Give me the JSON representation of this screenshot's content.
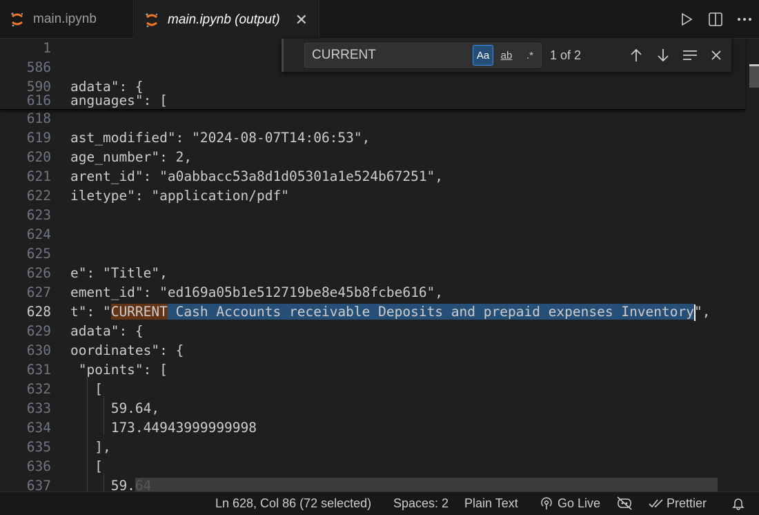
{
  "tabs": [
    {
      "label": "main.ipynb",
      "active": false
    },
    {
      "label": "main.ipynb (output)",
      "active": true
    }
  ],
  "icons": {
    "tab_icon": "jupyter-icon",
    "tab_close": "close-icon",
    "run": "play-icon",
    "split": "split-editor-icon",
    "more": "more-icon"
  },
  "colors": {
    "accent": "#3794ff",
    "selection": "#264f78",
    "current_match": "#623315",
    "jupyter_orange": "#f37726"
  },
  "find": {
    "query": "CURRENT",
    "match_case_label": "Aa",
    "whole_word_label": "ab",
    "regex_label": ".*",
    "count": "1 of 2",
    "match_case_enabled": true
  },
  "sticky_lines": [
    {
      "num": "1",
      "code": ""
    },
    {
      "num": "586",
      "code": ""
    },
    {
      "num": "590",
      "code": "adata\": {"
    },
    {
      "num": "616",
      "code": "anguages\": ["
    }
  ],
  "lines": [
    {
      "num": "618",
      "code": ""
    },
    {
      "num": "619",
      "code": "ast_modified\": \"2024-08-07T14:06:53\","
    },
    {
      "num": "620",
      "code": "age_number\": 2,"
    },
    {
      "num": "621",
      "code": "arent_id\": \"a0abbacc53a8d1d05301a1e524b67251\","
    },
    {
      "num": "622",
      "code": "iletype\": \"application/pdf\""
    },
    {
      "num": "623",
      "code": ""
    },
    {
      "num": "624",
      "code": ""
    },
    {
      "num": "625",
      "code": ""
    },
    {
      "num": "626",
      "code": "e\": \"Title\","
    },
    {
      "num": "627",
      "code": "ement_id\": \"ed169a05b1e512719be8e45b8fcbe616\","
    },
    {
      "num": "628",
      "code_pre": "t\": \"",
      "match": "CURRENT",
      "selected": " Cash Accounts receivable Deposits and prepaid expenses Inventory",
      "code_post": "\","
    },
    {
      "num": "629",
      "code": "adata\": {"
    },
    {
      "num": "630",
      "code": "oordinates\": {"
    },
    {
      "num": "631",
      "code": " \"points\": ["
    },
    {
      "num": "632",
      "code": "   ["
    },
    {
      "num": "633",
      "code": "     59.64,"
    },
    {
      "num": "634",
      "code": "     173.44943999999998"
    },
    {
      "num": "635",
      "code": "   ],"
    },
    {
      "num": "636",
      "code": "   ["
    },
    {
      "num": "637",
      "code": "     59.64"
    }
  ],
  "status": {
    "position": "Ln 628, Col 86 (72 selected)",
    "spaces": "Spaces: 2",
    "language": "Plain Text",
    "go_live": "Go Live",
    "prettier": "Prettier"
  }
}
